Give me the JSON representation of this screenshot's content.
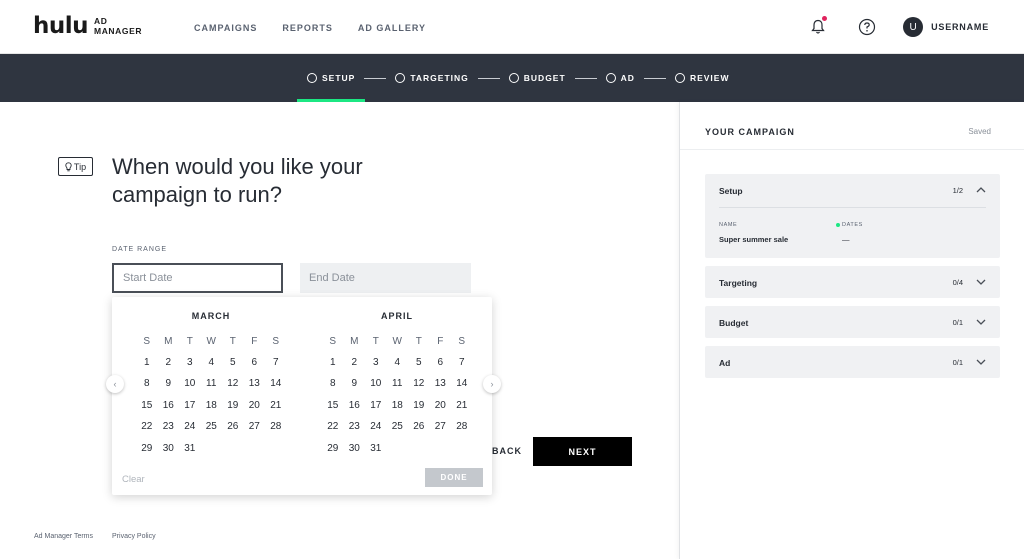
{
  "nav": {
    "logo_main": "hulu",
    "logo_sub_line1": "AD",
    "logo_sub_line2": "MANAGER",
    "links": [
      "CAMPAIGNS",
      "REPORTS",
      "AD GALLERY"
    ],
    "username": "USERNAME",
    "avatar_initial": "U",
    "icons": [
      "bell-icon",
      "help-icon"
    ]
  },
  "stepper": {
    "steps": [
      "SETUP",
      "TARGETING",
      "BUDGET",
      "AD",
      "REVIEW"
    ],
    "active_index": 0
  },
  "main": {
    "tip_label": "Tip",
    "question": "When would you like your campaign to run?",
    "date_range_label": "DATE RANGE",
    "start_date_placeholder": "Start Date",
    "end_date_placeholder": "End Date",
    "back_label": "BACK",
    "next_label": "NEXT"
  },
  "calendar": {
    "weekdays": [
      "S",
      "M",
      "T",
      "W",
      "T",
      "F",
      "S"
    ],
    "months": [
      {
        "name": "MARCH",
        "start_weekday": 0,
        "days": 31
      },
      {
        "name": "APRIL",
        "start_weekday": 0,
        "days": 31
      }
    ],
    "clear_label": "Clear",
    "done_label": "DONE"
  },
  "footer": {
    "links": [
      "Ad Manager Terms",
      "Privacy Policy"
    ]
  },
  "panel": {
    "title": "YOUR CAMPAIGN",
    "status": "Saved",
    "sections": [
      {
        "name": "Setup",
        "count": "1/2",
        "expanded": true
      },
      {
        "name": "Targeting",
        "count": "0/4",
        "expanded": false
      },
      {
        "name": "Budget",
        "count": "0/1",
        "expanded": false
      },
      {
        "name": "Ad",
        "count": "0/1",
        "expanded": false
      }
    ],
    "setup_details": {
      "name_label": "NAME",
      "name_value": "Super summer sale",
      "dates_label": "DATES",
      "dates_value": "—"
    }
  },
  "colors": {
    "accent_green": "#1ce783",
    "stepbar_bg": "#2f3540",
    "notification_dot": "#e0245e"
  }
}
